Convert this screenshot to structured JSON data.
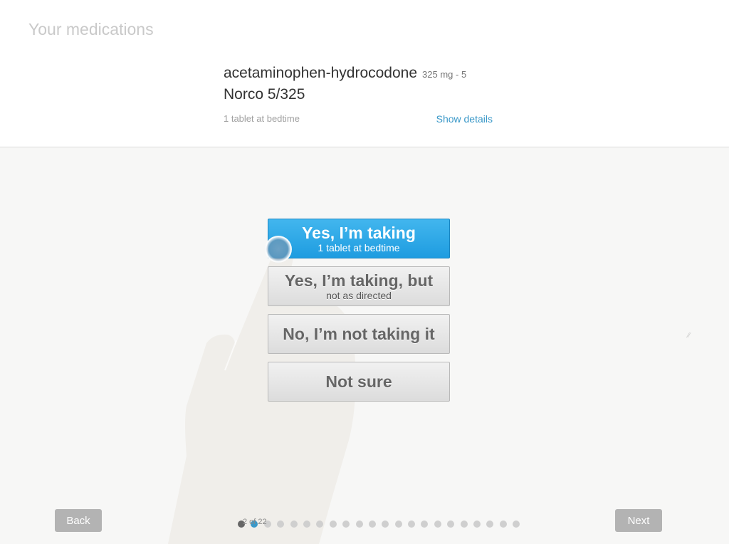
{
  "header": {
    "title": "Your medications"
  },
  "medication": {
    "name": "acetaminophen-hydrocodone",
    "dose": "325 mg - 5",
    "brand": "Norco 5/325",
    "instructions": "1 tablet at bedtime",
    "details_link": "Show details"
  },
  "options": [
    {
      "main": "Yes, I’m taking",
      "sub": "1 tablet at bedtime",
      "selected": true
    },
    {
      "main": "Yes, I’m taking, but",
      "sub": "not as directed",
      "selected": false
    },
    {
      "main": "No, I’m not taking it",
      "sub": "",
      "selected": false
    },
    {
      "main": "Not sure",
      "sub": "",
      "selected": false
    }
  ],
  "nav": {
    "back_label": "Back",
    "next_label": "Next",
    "page_indicator": "2 of 22",
    "total_pages": 22,
    "current_page": 2
  },
  "colors": {
    "accent": "#2aa6e6",
    "link": "#3a98c8",
    "nav_button": "#b3b3b3"
  }
}
